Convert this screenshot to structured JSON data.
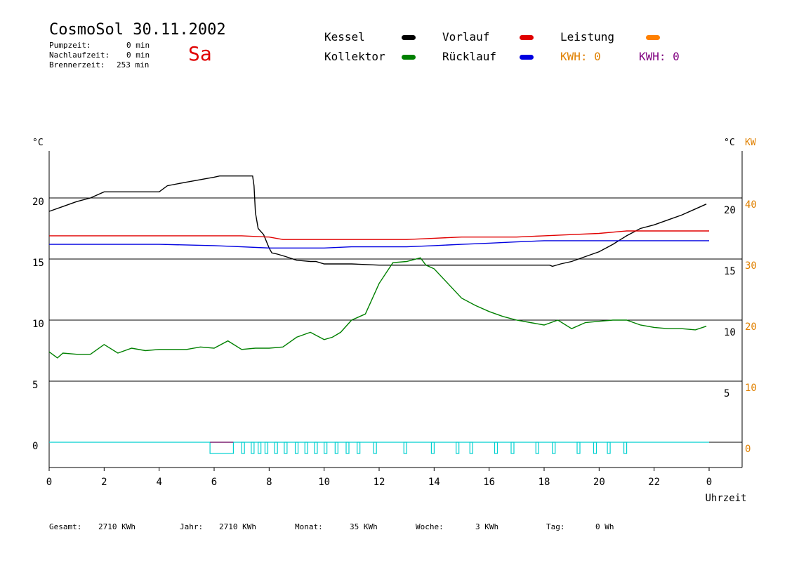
{
  "header": {
    "title": "CosmoSol 30.11.2002",
    "day": "Sa",
    "stats": [
      {
        "label": "Pumpzeit:",
        "value": "0 min"
      },
      {
        "label": "Nachlaufzeit:",
        "value": "0 min"
      },
      {
        "label": "Brennerzeit:",
        "value": "253 min"
      }
    ]
  },
  "legend": {
    "items": [
      {
        "label": "Kessel",
        "color": "#000000"
      },
      {
        "label": "Kollektor",
        "color": "#008000"
      },
      {
        "label": "Vorlauf",
        "color": "#e00000"
      },
      {
        "label": "Rücklauf",
        "color": "#0000e0"
      },
      {
        "label": "Leistung",
        "color": "#ff8000"
      }
    ],
    "kwh": [
      {
        "label": "KWH: 0",
        "color": "#e08000"
      },
      {
        "label": "KWH: 0",
        "color": "#800080"
      }
    ]
  },
  "footer": [
    {
      "label": "Gesamt:",
      "value": "2710 KWh"
    },
    {
      "label": "Jahr:",
      "value": "2710 KWh"
    },
    {
      "label": "Monat:",
      "value": "35 KWh"
    },
    {
      "label": "Woche:",
      "value": "3 KWh"
    },
    {
      "label": "Tag:",
      "value": "0 Wh"
    }
  ],
  "chart_data": {
    "type": "line",
    "xlabel": "Uhrzeit",
    "ylabel_left": "°C",
    "ylabel_right": "°C",
    "ylabel_right_power": "KW",
    "xlim": [
      0,
      24
    ],
    "ylim": [
      -2,
      25
    ],
    "x_ticks": [
      0,
      2,
      4,
      6,
      8,
      10,
      12,
      14,
      16,
      18,
      20,
      22,
      24
    ],
    "x_tick_labels": [
      "0",
      "2",
      "4",
      "6",
      "8",
      "10",
      "12",
      "14",
      "16",
      "18",
      "20",
      "22",
      "0"
    ],
    "y_ticks": [
      0,
      5,
      10,
      15,
      20
    ],
    "y_tick_labels_left": [
      "0",
      "5",
      "10",
      "15",
      "20"
    ],
    "y_tick_labels_right": [
      "",
      "5",
      "10",
      "15",
      "20"
    ],
    "y_tick_labels_power": [
      "0",
      "10",
      "20",
      "30",
      "40"
    ],
    "grid": "horizontal",
    "series": [
      {
        "name": "Kessel",
        "color": "#000000",
        "x": [
          0,
          0.5,
          1,
          1.5,
          2,
          2.1,
          4,
          4.3,
          5,
          5.5,
          6,
          6.2,
          7.4,
          7.45,
          7.5,
          7.6,
          7.8,
          8,
          8.1,
          8.3,
          8.6,
          9,
          9.5,
          9.7,
          10,
          11,
          12,
          13,
          14,
          15,
          16,
          17,
          18.2,
          18.3,
          18.6,
          19,
          19.5,
          20,
          20.5,
          21,
          21.5,
          22,
          22.5,
          23,
          23.5,
          23.9
        ],
        "y": [
          18.9,
          19.3,
          19.7,
          20.0,
          20.5,
          20.5,
          20.5,
          21.0,
          21.3,
          21.5,
          21.7,
          21.8,
          21.8,
          21.0,
          18.8,
          17.5,
          17.0,
          15.9,
          15.5,
          15.4,
          15.2,
          14.9,
          14.8,
          14.8,
          14.6,
          14.6,
          14.5,
          14.5,
          14.5,
          14.5,
          14.5,
          14.5,
          14.5,
          14.4,
          14.6,
          14.8,
          15.2,
          15.6,
          16.2,
          16.9,
          17.5,
          17.8,
          18.2,
          18.6,
          19.1,
          19.5
        ]
      },
      {
        "name": "Vorlauf",
        "color": "#e00000",
        "x": [
          0,
          2,
          4,
          6,
          7,
          8,
          8.5,
          9,
          10,
          11,
          12,
          13,
          14,
          15,
          16,
          17,
          18,
          19,
          20,
          21,
          22,
          23,
          24
        ],
        "y": [
          16.9,
          16.9,
          16.9,
          16.9,
          16.9,
          16.8,
          16.6,
          16.6,
          16.6,
          16.6,
          16.6,
          16.6,
          16.7,
          16.8,
          16.8,
          16.8,
          16.9,
          17.0,
          17.1,
          17.3,
          17.3,
          17.3,
          17.3
        ]
      },
      {
        "name": "Rücklauf",
        "color": "#0000e0",
        "x": [
          0,
          2,
          4,
          6,
          7,
          8,
          9,
          10,
          11,
          12,
          13,
          14,
          15,
          16,
          17,
          18,
          19,
          20,
          21,
          22,
          23,
          24
        ],
        "y": [
          16.2,
          16.2,
          16.2,
          16.1,
          16.0,
          15.9,
          15.9,
          15.9,
          16.0,
          16.0,
          16.0,
          16.1,
          16.2,
          16.3,
          16.4,
          16.5,
          16.5,
          16.5,
          16.5,
          16.5,
          16.5,
          16.5
        ]
      },
      {
        "name": "Kollektor",
        "color": "#008000",
        "x": [
          0,
          0.3,
          0.5,
          1,
          1.5,
          2,
          2.5,
          3,
          3.5,
          4,
          4.5,
          5,
          5.5,
          6,
          6.5,
          7,
          7.5,
          8,
          8.5,
          9,
          9.5,
          10,
          10.3,
          10.6,
          11,
          11.5,
          12,
          12.5,
          13,
          13.5,
          13.7,
          14,
          14.5,
          15,
          15.5,
          16,
          16.5,
          17,
          17.5,
          18,
          18.5,
          19,
          19.5,
          20,
          20.5,
          21,
          21.5,
          22,
          22.5,
          23,
          23.5,
          23.9
        ],
        "y": [
          7.4,
          6.9,
          7.3,
          7.2,
          7.2,
          8.0,
          7.3,
          7.7,
          7.5,
          7.6,
          7.6,
          7.6,
          7.8,
          7.7,
          8.3,
          7.6,
          7.7,
          7.7,
          7.8,
          8.6,
          9.0,
          8.4,
          8.6,
          9.0,
          10.0,
          10.5,
          13.0,
          14.7,
          14.8,
          15.1,
          14.5,
          14.2,
          13.0,
          11.8,
          11.2,
          10.7,
          10.3,
          10.0,
          9.8,
          9.6,
          10.0,
          9.3,
          9.8,
          9.9,
          10.0,
          10.0,
          9.6,
          9.4,
          9.3,
          9.3,
          9.2,
          9.5
        ]
      }
    ],
    "pump_bars": {
      "color": "#00d0d0",
      "wide_block": [
        5.85,
        6.7
      ],
      "pulses": [
        7.0,
        7.35,
        7.6,
        7.85,
        8.2,
        8.55,
        8.95,
        9.3,
        9.65,
        10.0,
        10.4,
        10.8,
        11.2,
        11.8,
        12.9,
        13.9,
        14.8,
        15.3,
        16.2,
        16.8,
        17.7,
        18.3,
        19.2,
        19.8,
        20.3,
        20.9
      ]
    },
    "baseline": 0
  }
}
